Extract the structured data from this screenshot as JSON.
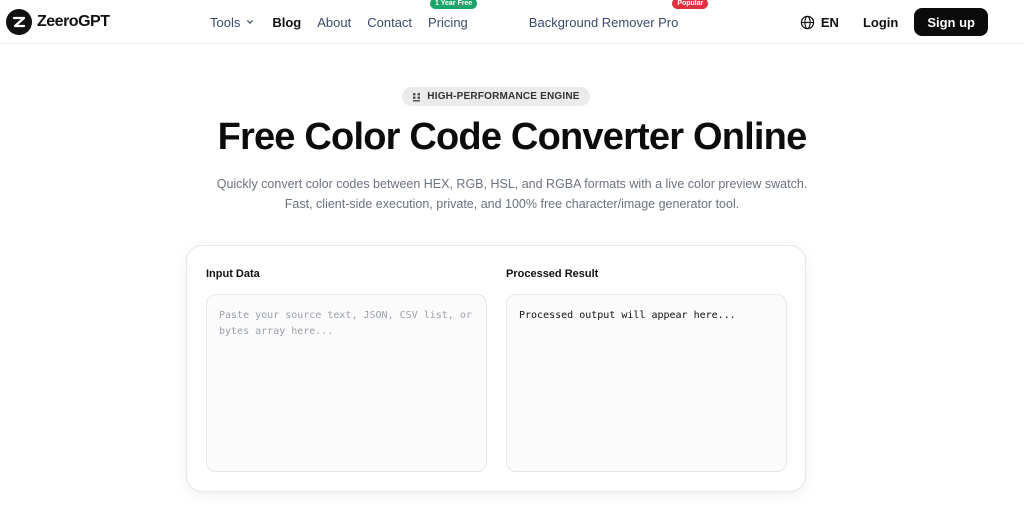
{
  "brand": {
    "name": "ZeeroGPT"
  },
  "nav": {
    "items": [
      {
        "label": "Tools",
        "has_dropdown": true
      },
      {
        "label": "Blog",
        "active": true
      },
      {
        "label": "About"
      },
      {
        "label": "Contact"
      },
      {
        "label": "Pricing",
        "badge": "1 Year Free",
        "badge_color": "#1aa56a"
      },
      {
        "label": "Background Remover Pro",
        "badge": "Popular",
        "badge_color": "#e0303f"
      }
    ],
    "language": "EN",
    "login": "Login",
    "signup": "Sign up"
  },
  "hero": {
    "pill": "HIGH-PERFORMANCE ENGINE",
    "title": "Free Color Code Converter Online",
    "subtitle_line1": "Quickly convert color codes between HEX, RGB, HSL, and RGBA formats with a live color preview swatch.",
    "subtitle_line2": "Fast, client-side execution, private, and 100% free character/image generator tool."
  },
  "converter": {
    "input_label": "Input Data",
    "input_placeholder": "Paste your source text, JSON, CSV list, or bytes array here...",
    "input_value": "",
    "output_label": "Processed Result",
    "output_text": "Processed output will appear here..."
  },
  "colors": {
    "primary": "#0b0b0b",
    "badge_green": "#1aa56a",
    "badge_red": "#e0303f",
    "muted_text": "#6b7280"
  }
}
